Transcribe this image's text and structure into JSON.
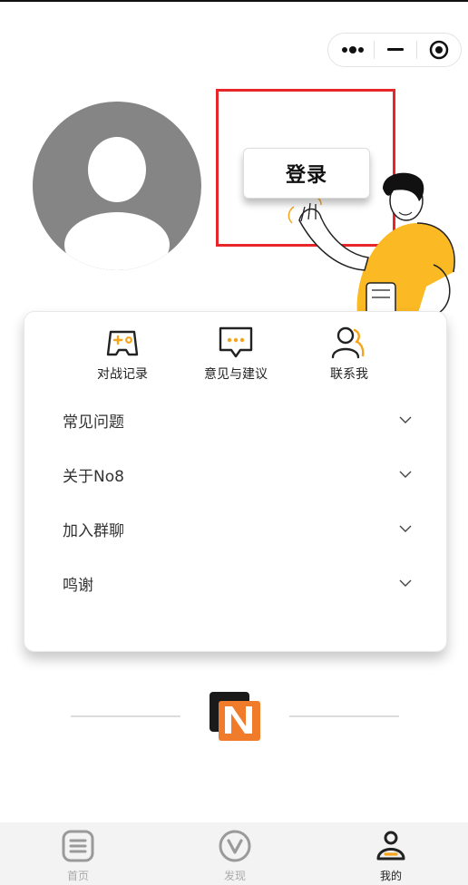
{
  "profile": {
    "login_label": "登录"
  },
  "quick_actions": [
    {
      "label": "对战记录",
      "icon": "gamepad-icon"
    },
    {
      "label": "意见与建议",
      "icon": "feedback-chat-icon"
    },
    {
      "label": "联系我",
      "icon": "contact-person-icon"
    }
  ],
  "menu": [
    {
      "label": "常见问题"
    },
    {
      "label": "关于No8"
    },
    {
      "label": "加入群聊"
    },
    {
      "label": "鸣谢"
    }
  ],
  "tabbar": {
    "tabs": [
      {
        "label": "首页",
        "icon": "home-list-icon",
        "active": false
      },
      {
        "label": "发现",
        "icon": "discover-v-icon",
        "active": false
      },
      {
        "label": "我的",
        "icon": "profile-person-icon",
        "active": true
      }
    ]
  },
  "colors": {
    "accent": "#f6a41b",
    "highlight": "#e8262a",
    "logo_orange": "#f07b2b",
    "logo_dark": "#1a1a1a"
  }
}
